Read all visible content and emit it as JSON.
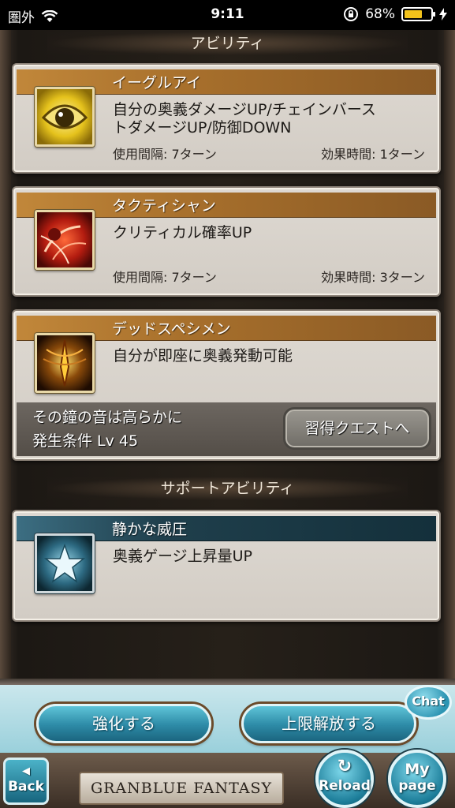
{
  "status_bar": {
    "carrier": "圏外",
    "time": "9:11",
    "battery_percent": "68%",
    "battery_level": 0.68
  },
  "sections": {
    "abilities_title": "アビリティ",
    "support_title": "サポートアビリティ"
  },
  "abilities": [
    {
      "name": "イーグルアイ",
      "icon": "eagle-eye-icon",
      "desc_line1": "自分の奥義ダメージUP/チェインバース",
      "desc_line2": "トダメージUP/防御DOWN",
      "interval": "使用間隔: 7ターン",
      "duration": "効果時間: 1ターン"
    },
    {
      "name": "タクティシャン",
      "icon": "tactician-icon",
      "desc_line1": "クリティカル確率UP",
      "interval": "使用間隔: 7ターン",
      "duration": "効果時間: 3ターン"
    },
    {
      "name": "デッドスペシメン",
      "icon": "dead-specimen-icon",
      "desc_line1": "自分が即座に奥義発動可能",
      "condition_quest": "その鐘の音は高らかに",
      "condition_level": "発生条件 Lv 45",
      "quest_button": "習得クエストへ"
    }
  ],
  "support_ability": {
    "name": "静かな威圧",
    "icon": "star-icon",
    "desc": "奥義ゲージ上昇量UP"
  },
  "buttons": {
    "enhance": "強化する",
    "limit_break": "上限解放する",
    "chat": "Chat",
    "back": "Back",
    "reload": "Reload",
    "mypage_line1": "My",
    "mypage_line2": "page"
  },
  "logo_text": "GRANBLUE FANTASY",
  "colors": {
    "ability_title_bar": "#a8702c",
    "support_title_bar": "#1f3f4c",
    "button_blue": "#2d8aa6"
  }
}
